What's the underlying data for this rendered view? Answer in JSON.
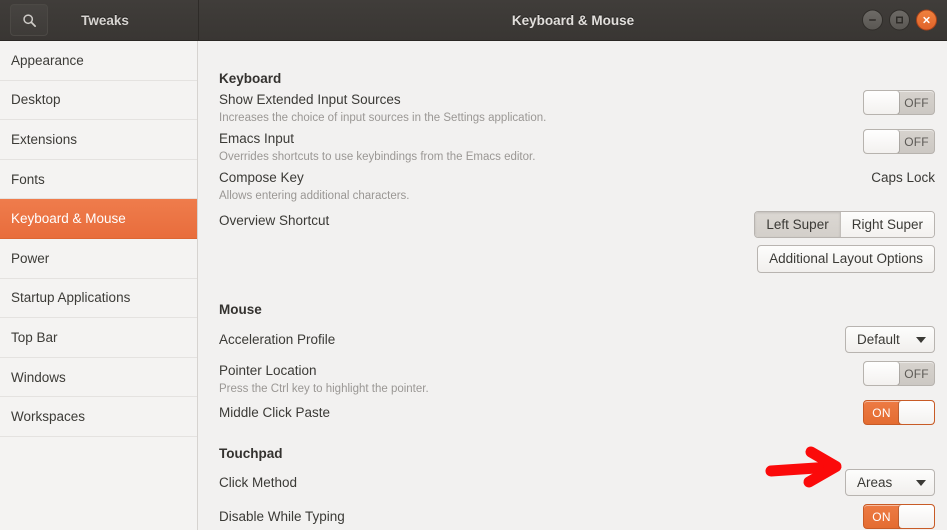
{
  "titlebar": {
    "search_icon": "search-icon",
    "app_title": "Tweaks",
    "window_title": "Keyboard & Mouse",
    "minimize_label": "minimize-icon",
    "maximize_label": "maximize-icon",
    "close_label": "close-icon"
  },
  "sidebar": {
    "items": [
      {
        "label": "Appearance",
        "active": false
      },
      {
        "label": "Desktop",
        "active": false
      },
      {
        "label": "Extensions",
        "active": false
      },
      {
        "label": "Fonts",
        "active": false
      },
      {
        "label": "Keyboard & Mouse",
        "active": true
      },
      {
        "label": "Power",
        "active": false
      },
      {
        "label": "Startup Applications",
        "active": false
      },
      {
        "label": "Top Bar",
        "active": false
      },
      {
        "label": "Windows",
        "active": false
      },
      {
        "label": "Workspaces",
        "active": false
      }
    ]
  },
  "sections": {
    "keyboard": {
      "title": "Keyboard",
      "rows": {
        "show_extended_input_sources": {
          "title": "Show Extended Input Sources",
          "description": "Increases the choice of input sources in the Settings application.",
          "toggle_state": "OFF"
        },
        "emacs_input": {
          "title": "Emacs Input",
          "description": "Overrides shortcuts to use keybindings from the Emacs editor.",
          "toggle_state": "OFF"
        },
        "compose_key": {
          "title": "Compose Key",
          "description": "Allows entering additional characters.",
          "value": "Caps Lock"
        },
        "overview_shortcut": {
          "title": "Overview Shortcut",
          "options": [
            {
              "label": "Left Super",
              "selected": true
            },
            {
              "label": "Right Super",
              "selected": false
            }
          ]
        },
        "additional_layout_options": {
          "button_label": "Additional Layout Options"
        }
      }
    },
    "mouse": {
      "title": "Mouse",
      "rows": {
        "acceleration_profile": {
          "title": "Acceleration Profile",
          "value": "Default"
        },
        "pointer_location": {
          "title": "Pointer Location",
          "description": "Press the Ctrl key to highlight the pointer.",
          "toggle_state": "OFF"
        },
        "middle_click_paste": {
          "title": "Middle Click Paste",
          "toggle_state": "ON"
        }
      }
    },
    "touchpad": {
      "title": "Touchpad",
      "rows": {
        "click_method": {
          "title": "Click Method",
          "value": "Areas"
        },
        "disable_while_typing": {
          "title": "Disable While Typing",
          "toggle_state": "ON"
        }
      }
    }
  },
  "annotation": {
    "arrow_color": "#fb0a0a",
    "points_to": "click-method-dropdown"
  },
  "colors": {
    "accent": "#e86d3c",
    "titlebar": "#3a3734",
    "content_bg": "#f2f1f0",
    "sidebar_bg": "#f4f3f2"
  }
}
